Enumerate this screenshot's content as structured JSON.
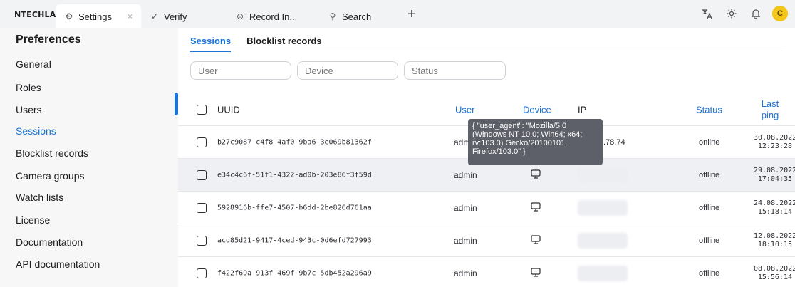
{
  "header": {
    "brand": "NTECHLAB",
    "tabs": [
      {
        "label": "Settings",
        "icon": "gear-icon",
        "close": "×"
      },
      {
        "label": "Verify",
        "icon": "verify-icon"
      },
      {
        "label": "Record In...",
        "icon": "record-icon"
      },
      {
        "label": "Search",
        "icon": "search-icon"
      }
    ],
    "new_tab": "+",
    "avatar_letter": "C"
  },
  "sidebar": {
    "title": "Preferences",
    "items": [
      {
        "label": "General"
      },
      {
        "label": "Roles"
      },
      {
        "label": "Users"
      },
      {
        "label": "Sessions"
      },
      {
        "label": "Blocklist records"
      },
      {
        "label": "Camera groups"
      },
      {
        "label": "Watch lists"
      },
      {
        "label": "License"
      },
      {
        "label": "Documentation"
      },
      {
        "label": "API documentation"
      }
    ]
  },
  "subtabs": [
    {
      "label": "Sessions"
    },
    {
      "label": "Blocklist records"
    }
  ],
  "filters": {
    "user_placeholder": "User",
    "device_placeholder": "Device",
    "status_placeholder": "Status"
  },
  "table": {
    "headers": {
      "uuid": "UUID",
      "user": "User",
      "device": "Device",
      "ip": "IP",
      "status": "Status",
      "last_ping": "Last ping"
    },
    "rows": [
      {
        "uuid": "b27c9087-c4f8-4af0-9ba6-3e069b81362f",
        "user": "admin",
        "ip_tail": ".78.74",
        "status": "online",
        "ping_date": "30.08.2022",
        "ping_time": "12:23:28"
      },
      {
        "uuid": "e34c4c6f-51f1-4322-ad0b-203e86f3f59d",
        "user": "admin",
        "status": "offline",
        "ping_date": "29.08.2022",
        "ping_time": "17:04:35"
      },
      {
        "uuid": "5928916b-ffe7-4507-b6dd-2be826d761aa",
        "user": "admin",
        "status": "offline",
        "ping_date": "24.08.2022",
        "ping_time": "15:18:14"
      },
      {
        "uuid": "acd85d21-9417-4ced-943c-0d6efd727993",
        "user": "admin",
        "status": "offline",
        "ping_date": "12.08.2022",
        "ping_time": "18:10:15"
      },
      {
        "uuid": "f422f69a-913f-469f-9b7c-5db452a296a9",
        "user": "admin",
        "status": "offline",
        "ping_date": "08.08.2022",
        "ping_time": "15:56:14"
      }
    ]
  },
  "tooltip": {
    "text": "{ \"user_agent\": \"Mozilla/5.0\n(Windows NT 10.0; Win64; x64;\nrv:103.0) Gecko/20100101\nFirefox/103.0\" }"
  },
  "colors": {
    "accent": "#1a73d9",
    "avatar": "#f3c419",
    "tooltip_bg": "#5d6068"
  }
}
